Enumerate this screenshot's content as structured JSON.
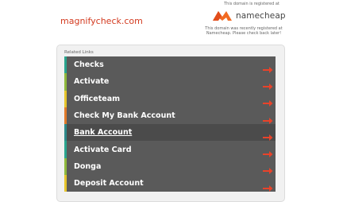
{
  "header": {
    "domain": "magnifycheck.com",
    "registered_note": "This domain is registered at",
    "registrar": "namecheap",
    "recent_note": "This domain was recently registered at Namecheap. Please check back later!"
  },
  "related": {
    "label": "Related Links",
    "items": [
      {
        "label": "Checks",
        "color": "#2aa58e"
      },
      {
        "label": "Activate",
        "color": "#8fb93c"
      },
      {
        "label": "Officeteam",
        "color": "#e6c52c"
      },
      {
        "label": "Check My Bank Account",
        "color": "#e07a2a"
      },
      {
        "label": "Bank Account",
        "color": "#2e8a8a"
      },
      {
        "label": "Activate Card",
        "color": "#2aa58e"
      },
      {
        "label": "Donga",
        "color": "#8fb93c"
      },
      {
        "label": "Deposit Account",
        "color": "#e6c52c"
      }
    ]
  },
  "colors": {
    "domain": "#d33a1f",
    "arrow": "#e8432a",
    "row_bg": "#5a5a5a",
    "logo_orange": "#f26a21"
  },
  "icons": {
    "arrow": "arrow-right-icon",
    "logo": "namecheap-logo-icon"
  }
}
